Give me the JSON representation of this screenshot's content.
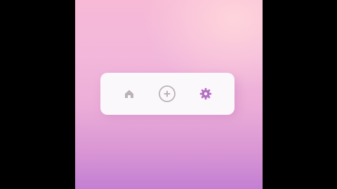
{
  "screen": {
    "background_top": "#f7b9d6",
    "background_bottom": "#c37fd3"
  },
  "tabbar": {
    "items": [
      {
        "id": "home",
        "icon": "home-icon",
        "color": "#b9b2b8",
        "active": false
      },
      {
        "id": "add",
        "icon": "plus-circle-icon",
        "color": "#b9b2b8",
        "active": false
      },
      {
        "id": "settings",
        "icon": "gear-icon",
        "color": "#b470c4",
        "active": true
      }
    ]
  }
}
